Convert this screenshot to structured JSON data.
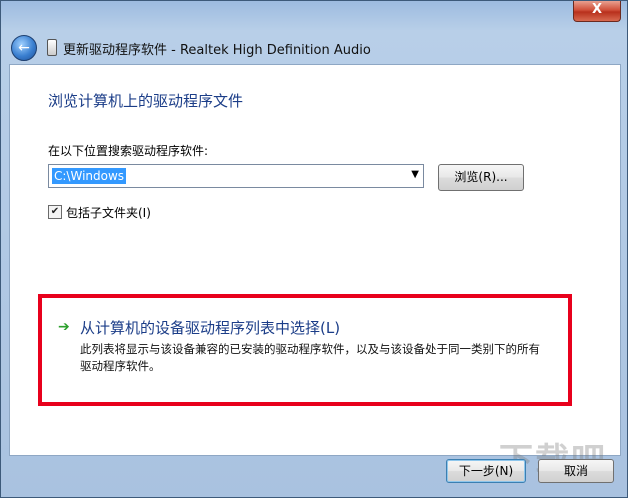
{
  "window": {
    "close_symbol": "X",
    "title": "更新驱动程序软件 - Realtek High Definition Audio"
  },
  "nav": {
    "back_icon": "back-arrow-icon",
    "device_icon": "audio-device-icon"
  },
  "content": {
    "heading": "浏览计算机上的驱动程序文件",
    "search_label": "在以下位置搜索驱动程序软件:",
    "path_value": "C:\\Windows",
    "browse_label": "浏览(R)...",
    "include_subfolders_label": "包括子文件夹(I)",
    "include_subfolders_checked": true
  },
  "option": {
    "arrow_icon": "green-arrow-icon",
    "title": "从计算机的设备驱动程序列表中选择(L)",
    "description": "此列表将显示与该设备兼容的已安装的驱动程序软件，以及与该设备处于同一类别下的所有驱动程序软件。"
  },
  "footer": {
    "next_label": "下一步(N)",
    "cancel_label": "取消"
  },
  "watermark": "下载吧",
  "colors": {
    "heading_blue": "#1b3d88",
    "highlight_red": "#e8001c",
    "selection_blue": "#3399ff"
  }
}
